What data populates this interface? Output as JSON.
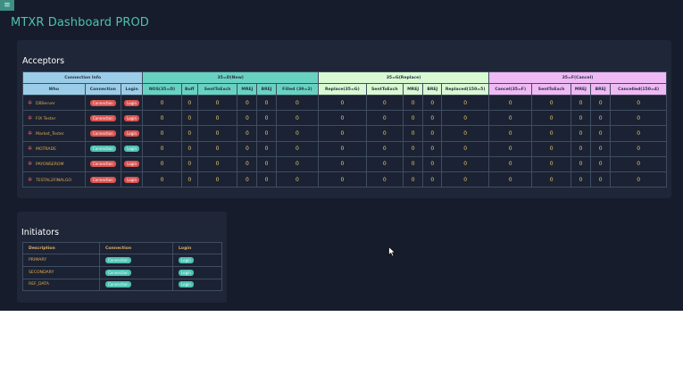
{
  "header": {
    "menu_icon": "hamburger-icon",
    "title": "MTXR Dashboard PROD"
  },
  "acceptors": {
    "title": "Acceptors",
    "groups": [
      {
        "label": "Connection Info",
        "color": "#9bcde8"
      },
      {
        "label": "35=D(New)",
        "color": "#68d2c1"
      },
      {
        "label": "35=G(Replace)",
        "color": "#d9f9d2"
      },
      {
        "label": "35=F(Cancel)",
        "color": "#efb9f4"
      }
    ],
    "columns": [
      "Who",
      "Connection",
      "Login",
      "NOS(35=D)",
      "Buff",
      "SentToExch",
      "MREJ",
      "BREJ",
      "Filled (39=2)",
      "Replace(35=G)",
      "SentToExch",
      "MREJ",
      "BREJ",
      "Replaced(150=5)",
      "Cancel(35=F)",
      "SentToExch",
      "MREJ",
      "BREJ",
      "Cancelled(150=4)"
    ],
    "rows": [
      {
        "who": "DBServer",
        "connection": "Connection",
        "connection_state": "down",
        "login": "Login",
        "login_state": "down",
        "values": [
          "0",
          "0",
          "0",
          "0",
          "0",
          "0",
          "0",
          "0",
          "0",
          "0",
          "0",
          "0",
          "0",
          "0",
          "0",
          "0"
        ]
      },
      {
        "who": "FIX Tester",
        "connection": "Connection",
        "connection_state": "down",
        "login": "Login",
        "login_state": "down",
        "values": [
          "0",
          "0",
          "0",
          "0",
          "0",
          "0",
          "0",
          "0",
          "0",
          "0",
          "0",
          "0",
          "0",
          "0",
          "0",
          "0"
        ]
      },
      {
        "who": "Market_Tester",
        "connection": "Connection",
        "connection_state": "down",
        "login": "Login",
        "login_state": "down",
        "values": [
          "0",
          "0",
          "0",
          "0",
          "0",
          "0",
          "0",
          "0",
          "0",
          "0",
          "0",
          "0",
          "0",
          "0",
          "0",
          "0"
        ]
      },
      {
        "who": "MOTRADE",
        "connection": "Connection",
        "connection_state": "up",
        "login": "Login",
        "login_state": "up",
        "values": [
          "0",
          "0",
          "0",
          "0",
          "0",
          "0",
          "0",
          "0",
          "0",
          "0",
          "0",
          "0",
          "0",
          "0",
          "0",
          "0"
        ]
      },
      {
        "who": "PAYONSEROM",
        "connection": "Connection",
        "connection_state": "down",
        "login": "Login",
        "login_state": "down",
        "values": [
          "0",
          "0",
          "0",
          "0",
          "0",
          "0",
          "0",
          "0",
          "0",
          "0",
          "0",
          "0",
          "0",
          "0",
          "0",
          "0"
        ]
      },
      {
        "who": "TESTAL2FINALGO",
        "connection": "Connection",
        "connection_state": "down",
        "login": "Login",
        "login_state": "down",
        "values": [
          "0",
          "0",
          "0",
          "0",
          "0",
          "0",
          "0",
          "0",
          "0",
          "0",
          "0",
          "0",
          "0",
          "0",
          "0",
          "0"
        ]
      }
    ]
  },
  "initiators": {
    "title": "Initiators",
    "columns": [
      "Description",
      "Connection",
      "Login"
    ],
    "rows": [
      {
        "description": "PRIMARY",
        "connection": "Connection",
        "login": "Login"
      },
      {
        "description": "SECONDARY",
        "connection": "Connection",
        "login": "Login"
      },
      {
        "description": "REF_DATA",
        "connection": "Connection",
        "login": "Login"
      }
    ]
  },
  "colors": {
    "status_up": "#4fc0b0",
    "status_down": "#d9534f",
    "accent": "#4fc0b0"
  },
  "cursor_icon": "mouse-pointer-icon"
}
